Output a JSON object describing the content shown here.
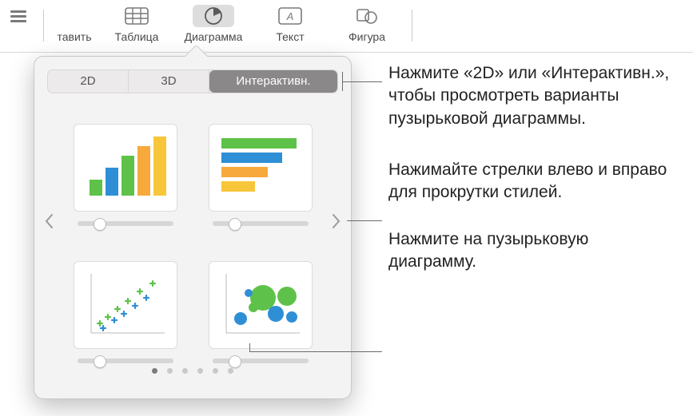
{
  "toolbar": {
    "insert": "тавить",
    "table": "Таблица",
    "chart": "Диаграмма",
    "text": "Текст",
    "shape": "Фигура"
  },
  "popover": {
    "segments": {
      "s2d": "2D",
      "s3d": "3D",
      "interactive": "Интерактивн."
    }
  },
  "callouts": {
    "c1": "Нажмите «2D» или «Интерактивн.», чтобы просмотреть варианты пузырьковой диаграммы.",
    "c2": "Нажимайте стрелки влево и вправо для прокрутки стилей.",
    "c3": "Нажмите на пузырьковую диаграмму."
  },
  "icons": {
    "view": "view-icon",
    "table": "table-icon",
    "chart": "pie-icon",
    "text": "text-icon",
    "shape": "shape-icon"
  },
  "colors": {
    "green": "#5ec24a",
    "blue": "#2f8fd6",
    "cyan": "#3fb6d4",
    "orange": "#f7a93b",
    "yellow": "#f7c63b"
  }
}
